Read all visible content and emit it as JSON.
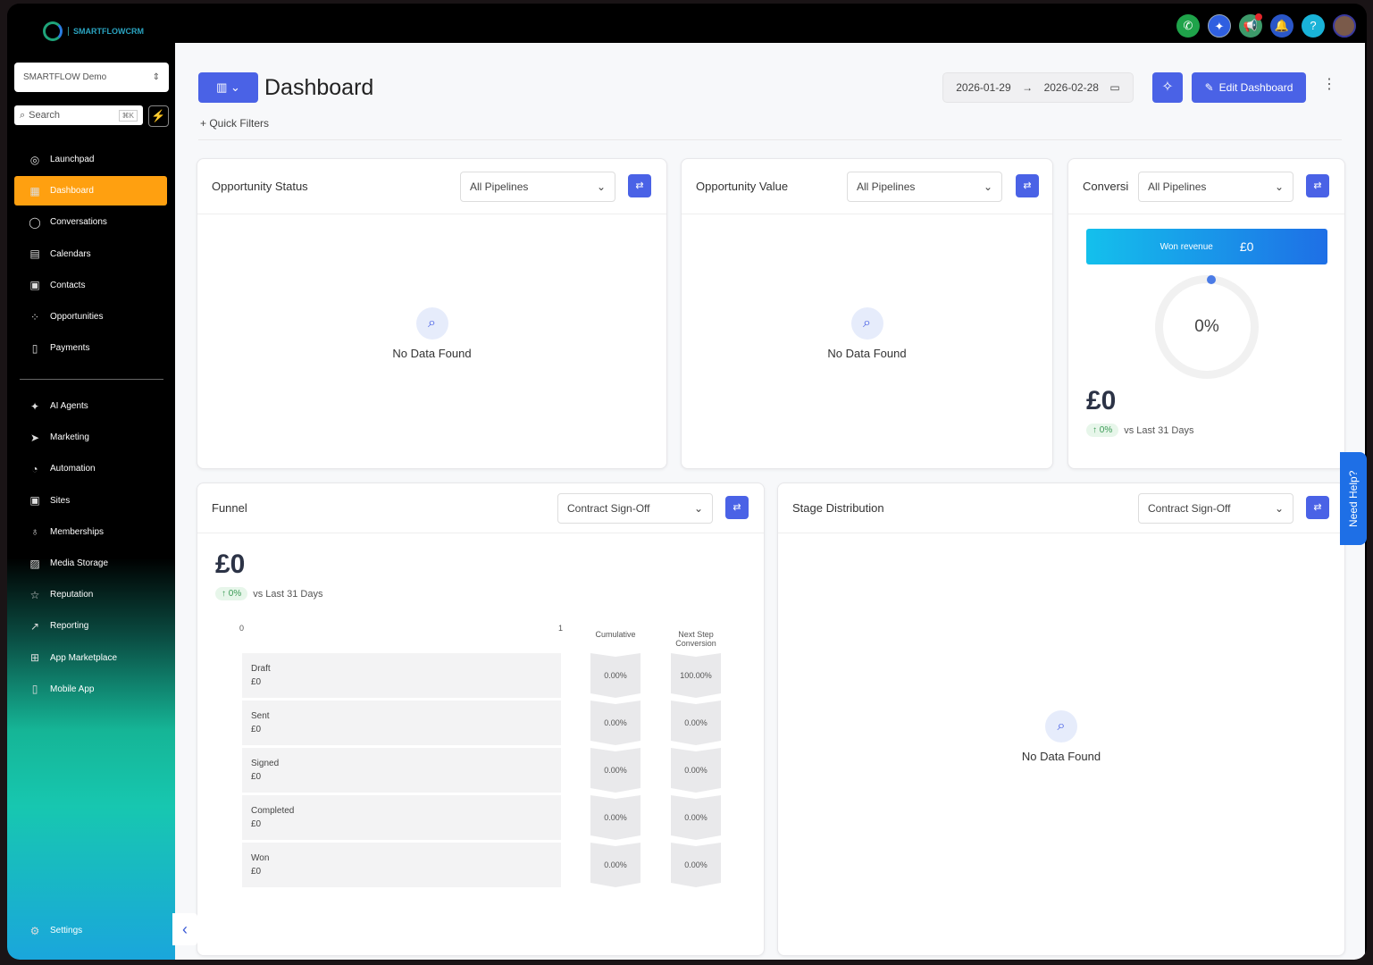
{
  "brand": {
    "logo_text": "SMARTFLOWCRM"
  },
  "location": "SMARTFLOW Demo",
  "search": {
    "label": "Search",
    "shortcut": "⌘K"
  },
  "nav": [
    {
      "label": "Launchpad",
      "icon": "launchpad-icon",
      "glyph": "◎"
    },
    {
      "label": "Dashboard",
      "icon": "dashboard-icon",
      "glyph": "▦",
      "active": true
    },
    {
      "label": "Conversations",
      "icon": "chat-icon",
      "glyph": "◯"
    },
    {
      "label": "Calendars",
      "icon": "calendar-icon",
      "glyph": "▤"
    },
    {
      "label": "Contacts",
      "icon": "contacts-icon",
      "glyph": "▣"
    },
    {
      "label": "Opportunities",
      "icon": "opportunities-icon",
      "glyph": "⁘"
    },
    {
      "label": "Payments",
      "icon": "payments-icon",
      "glyph": "▯"
    },
    {
      "label": "AI Agents",
      "icon": "ai-agents-icon",
      "glyph": "✦"
    },
    {
      "label": "Marketing",
      "icon": "send-icon",
      "glyph": "➤"
    },
    {
      "label": "Automation",
      "icon": "automation-icon",
      "glyph": "◔"
    },
    {
      "label": "Sites",
      "icon": "sites-icon",
      "glyph": "▣"
    },
    {
      "label": "Memberships",
      "icon": "membership-icon",
      "glyph": "♁"
    },
    {
      "label": "Media Storage",
      "icon": "media-icon",
      "glyph": "▨"
    },
    {
      "label": "Reputation",
      "icon": "star-icon",
      "glyph": "☆"
    },
    {
      "label": "Reporting",
      "icon": "trend-icon",
      "glyph": "↗"
    },
    {
      "label": "App Marketplace",
      "icon": "apps-icon",
      "glyph": "⊞"
    },
    {
      "label": "Mobile App",
      "icon": "mobile-icon",
      "glyph": "▯"
    }
  ],
  "settings_label": "Settings",
  "header": {
    "title": "Dashboard",
    "quick_filters": "Quick Filters",
    "date_from": "2026-01-29",
    "date_to": "2026-02-28",
    "edit_label": "Edit Dashboard"
  },
  "need_help": "Need Help?",
  "no_data": "No Data Found",
  "cards": {
    "opp_status": {
      "title": "Opportunity Status",
      "filter": "All Pipelines"
    },
    "opp_value": {
      "title": "Opportunity Value",
      "filter": "All Pipelines"
    },
    "conversion": {
      "title": "Conversi",
      "filter": "All Pipelines",
      "won_label": "Won revenue",
      "won_value": "£0",
      "gauge": "0%",
      "gauge_value": 0,
      "amount": "£0",
      "change": "0%",
      "compare": "vs Last 31 Days"
    },
    "funnel": {
      "title": "Funnel",
      "filter": "Contract Sign-Off",
      "amount": "£0",
      "change": "0%",
      "compare": "vs Last 31 Days",
      "axis_min": "0",
      "axis_max": "1",
      "col_cumulative": "Cumulative",
      "col_next": "Next Step Conversion",
      "stages": [
        {
          "name": "Draft",
          "value": "£0",
          "cumulative": "0.00%",
          "next": "100.00%"
        },
        {
          "name": "Sent",
          "value": "£0",
          "cumulative": "0.00%",
          "next": "0.00%"
        },
        {
          "name": "Signed",
          "value": "£0",
          "cumulative": "0.00%",
          "next": "0.00%"
        },
        {
          "name": "Completed",
          "value": "£0",
          "cumulative": "0.00%",
          "next": "0.00%"
        },
        {
          "name": "Won",
          "value": "£0",
          "cumulative": "0.00%",
          "next": "0.00%"
        }
      ]
    },
    "stage_dist": {
      "title": "Stage Distribution",
      "filter": "Contract Sign-Off"
    }
  },
  "colors": {
    "accent": "#4a62e6",
    "active_nav": "#ffa010"
  }
}
